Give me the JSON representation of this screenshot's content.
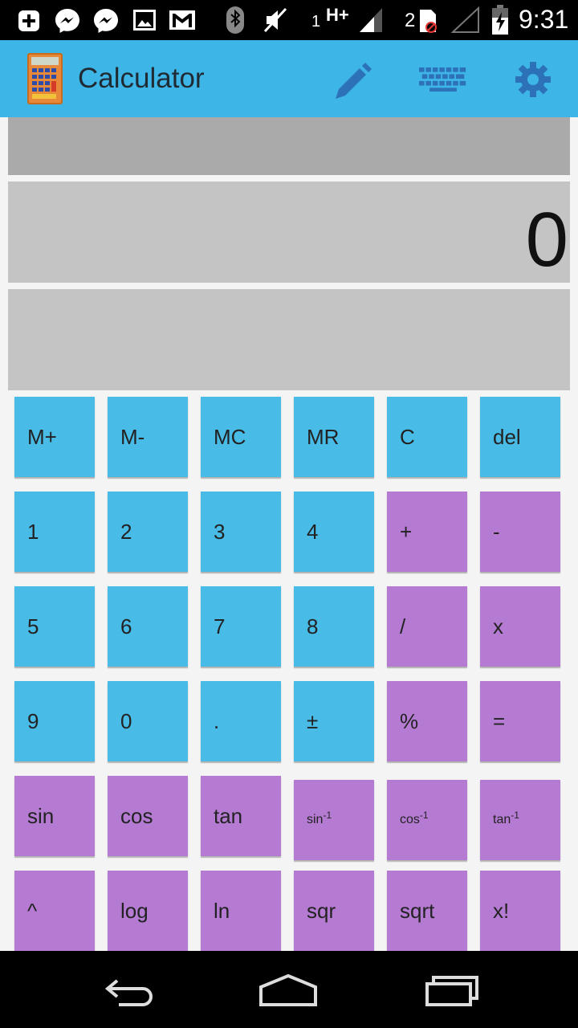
{
  "status_bar": {
    "sim1_label": "1",
    "network_type": "H+",
    "sim2_label": "2",
    "time": "9:31",
    "icons": [
      "add-icon",
      "messenger-icon",
      "messenger-icon",
      "gallery-icon",
      "gmail-icon",
      "bluetooth-icon",
      "mute-icon",
      "signal-icon",
      "sim-disabled-icon",
      "signal-icon",
      "battery-icon"
    ]
  },
  "action_bar": {
    "title": "Calculator",
    "background": "#3db5e6",
    "actions": [
      "pencil-icon",
      "keyboard-icon",
      "gear-icon"
    ]
  },
  "display": {
    "value": "0"
  },
  "keys": {
    "m_plus": "M+",
    "m_minus": "M-",
    "mc": "MC",
    "mr": "MR",
    "clear": "C",
    "del": "del",
    "k1": "1",
    "k2": "2",
    "k3": "3",
    "k4": "4",
    "plus": "+",
    "minus": "-",
    "k5": "5",
    "k6": "6",
    "k7": "7",
    "k8": "8",
    "divide": "/",
    "multiply": "x",
    "k9": "9",
    "k0": "0",
    "dot": ".",
    "plusminus": "±",
    "percent": "%",
    "equals": "=",
    "sin": "sin",
    "cos": "cos",
    "tan": "tan",
    "asin_base": "sin",
    "acos_base": "cos",
    "atan_base": "tan",
    "inverse_sup": "-1",
    "pow": "^",
    "log": "log",
    "ln": "ln",
    "sqr": "sqr",
    "sqrt": "sqrt",
    "fact": "x!"
  },
  "colors": {
    "key_blue": "#48bbe6",
    "key_purple": "#b57bd3"
  },
  "nav_bar": {
    "icons": [
      "back-icon",
      "home-icon",
      "recents-icon"
    ]
  }
}
